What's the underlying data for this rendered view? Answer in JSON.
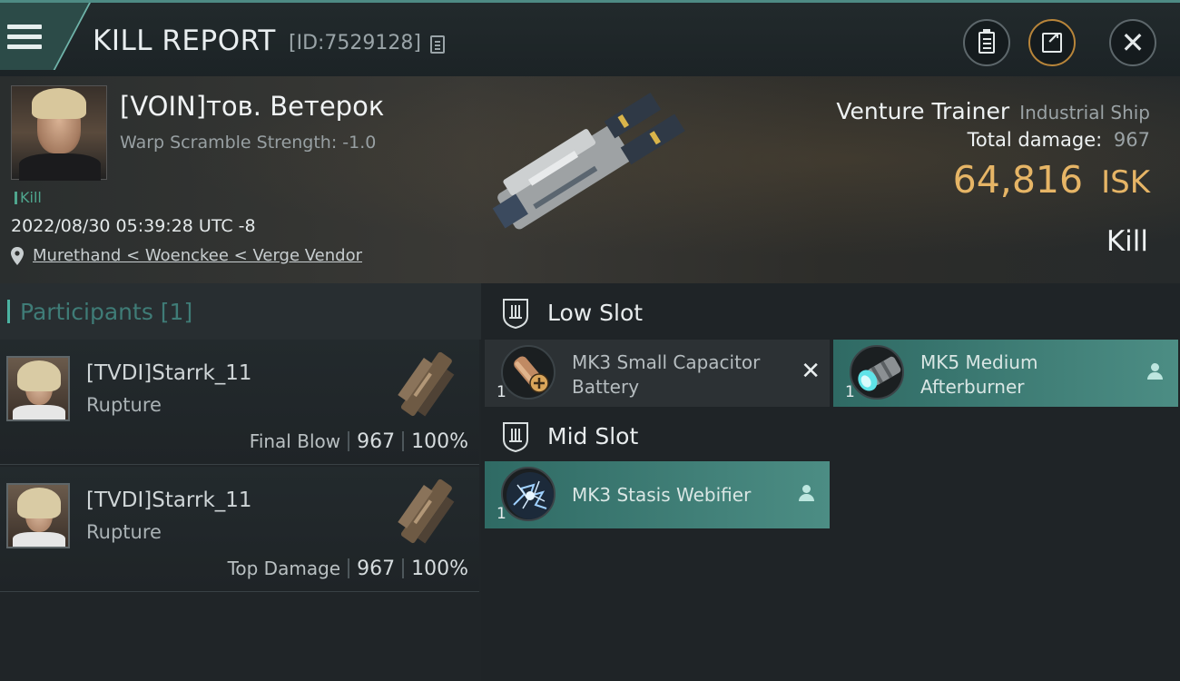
{
  "header": {
    "title": "KILL REPORT",
    "report_id": "[ID:7529128]",
    "icons": [
      "menu-icon",
      "copy-icon",
      "report-icon",
      "share-icon",
      "close-icon"
    ]
  },
  "victim": {
    "name": "[VOIN]тов. Ветерок",
    "warp_scramble": "Warp Scramble Strength: -1.0",
    "kill_tag": "Kill",
    "timestamp": "2022/08/30 05:39:28 UTC -8",
    "location": "Murethand < Woenckee < Verge Vendor",
    "ship_name": "Venture Trainer",
    "ship_class": "Industrial Ship",
    "total_damage_label": "Total damage:",
    "total_damage": "967",
    "isk_value": "64,816",
    "isk_unit": "ISK",
    "result": "Kill"
  },
  "participants": {
    "title": "Participants [1]",
    "items": [
      {
        "name": "[TVDI]Starrk_11",
        "ship": "Rupture",
        "role": "Final Blow",
        "damage": "967",
        "percent": "100%"
      },
      {
        "name": "[TVDI]Starrk_11",
        "ship": "Rupture",
        "role": "Top Damage",
        "damage": "967",
        "percent": "100%"
      }
    ]
  },
  "fitting": {
    "low_slot": {
      "title": "Low Slot",
      "modules": [
        {
          "name": "MK3 Small Capacitor Battery",
          "qty": "1",
          "status": "destroyed"
        },
        {
          "name": "MK5 Medium Afterburner",
          "qty": "1",
          "status": "dropped"
        }
      ]
    },
    "mid_slot": {
      "title": "Mid Slot",
      "modules": [
        {
          "name": "MK3 Stasis Webifier",
          "qty": "1",
          "status": "dropped"
        }
      ]
    }
  },
  "colors": {
    "accent": "#4bb3a2",
    "isk": "#e6b566",
    "active_module": "#4c8d84"
  }
}
